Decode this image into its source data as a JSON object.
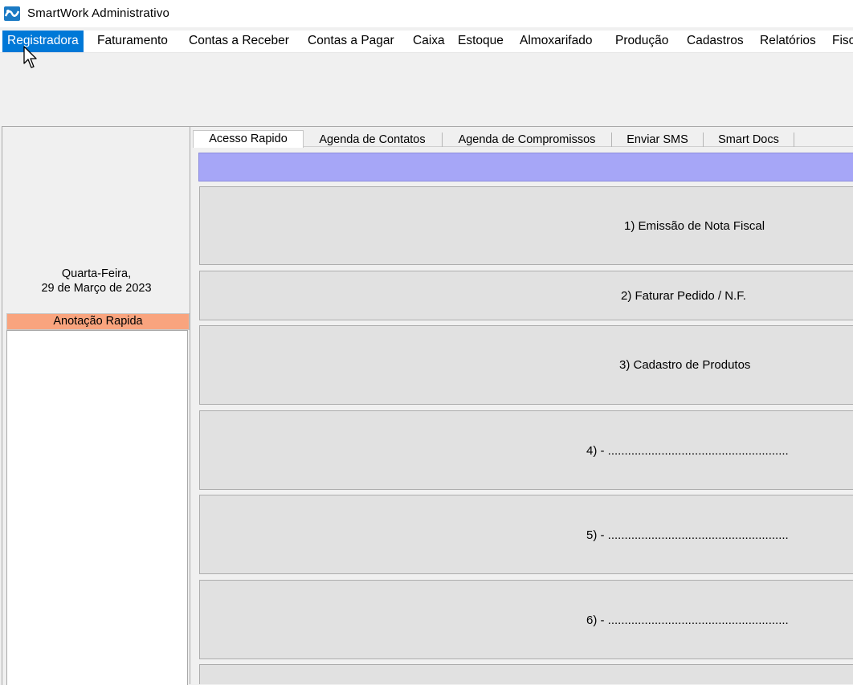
{
  "window": {
    "title": "SmartWork Administrativo",
    "app_icon": "smartwork-logo-icon"
  },
  "menu": [
    {
      "label": "Registradora",
      "id": "registradora",
      "active": true
    },
    {
      "label": "Faturamento",
      "id": "faturamento"
    },
    {
      "label": "Contas a Receber",
      "id": "contas-a-receber"
    },
    {
      "label": "Contas a Pagar",
      "id": "contas-a-pagar"
    },
    {
      "label": "Caixa",
      "id": "caixa"
    },
    {
      "label": "Estoque",
      "id": "estoque"
    },
    {
      "label": "Almoxarifado",
      "id": "almoxarifado"
    },
    {
      "label": "Produção",
      "id": "producao"
    },
    {
      "label": "Cadastros",
      "id": "cadastros"
    },
    {
      "label": "Relatórios",
      "id": "relatorios"
    },
    {
      "label": "Fisc",
      "id": "fiscal"
    }
  ],
  "left_panel": {
    "weekday": "Quarta-Feira,",
    "date": "29 de Março de 2023",
    "note_title": "Anotação Rapida",
    "note_text": ""
  },
  "tabs": [
    {
      "label": "Acesso Rapido",
      "active": true
    },
    {
      "label": "Agenda de Contatos"
    },
    {
      "label": "Agenda de Compromissos"
    },
    {
      "label": "Enviar SMS"
    },
    {
      "label": "Smart Docs"
    }
  ],
  "quick_actions": [
    {
      "label": "1) Emissão de Nota Fiscal"
    },
    {
      "label": "2) Faturar Pedido / N.F."
    },
    {
      "label": "3) Cadastro de Produtos"
    },
    {
      "label": "4) - ......................................................"
    },
    {
      "label": "5) - ......................................................"
    },
    {
      "label": "6) - ......................................................"
    },
    {
      "label": ""
    }
  ],
  "colors": {
    "menu_active": "#0078d7",
    "note_header": "#f9a47e",
    "accent_bar": "#a6a6f7",
    "button_face": "#e1e1e1"
  }
}
